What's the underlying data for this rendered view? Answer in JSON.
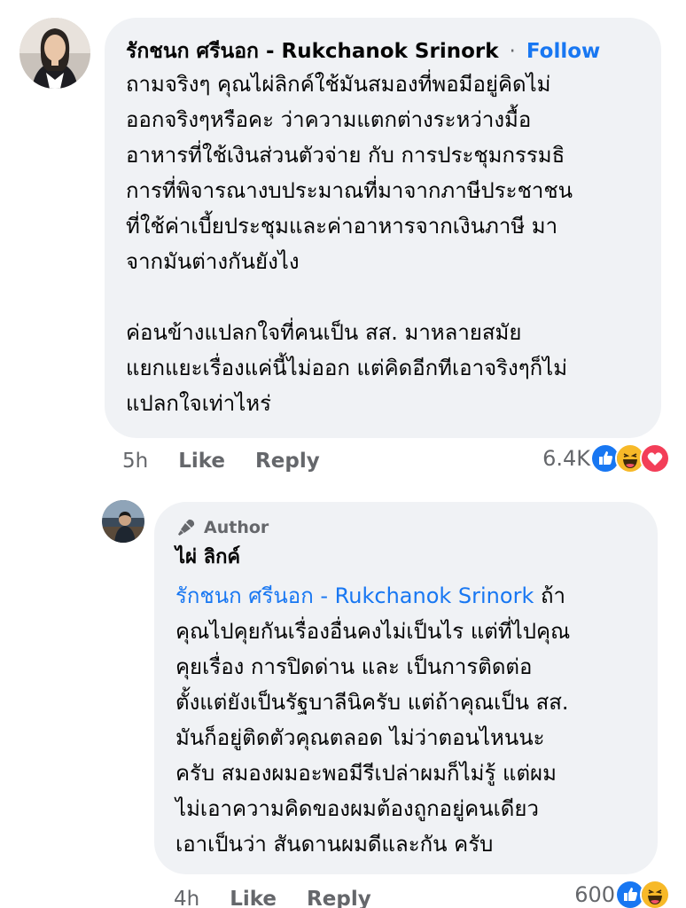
{
  "comment": {
    "author": "รักชนก ศรีนอก - Rukchanok Srinork",
    "separator": "·",
    "follow_label": "Follow",
    "lines": [
      "ถามจริงๆ คุณไผ่ลิกค์ใช้มันสมองที่พอมีอยู่คิดไม่",
      "ออกจริงๆหรือคะ ว่าความแตกต่างระหว่างมื้อ",
      "อาหารที่ใช้เงินส่วนตัวจ่าย กับ การประชุมกรรมธิ",
      "การที่พิจารณางบประมาณที่มาจากภาษีประชาชน",
      "ที่ใช้ค่าเบี้ยประชุมและค่าอาหารจากเงินภาษี มา",
      "จากมันต่างกันยังไง"
    ],
    "lines_2": [
      "ค่อนข้างแปลกใจที่คนเป็น สส. มาหลายสมัย",
      "แยกแยะเรื่องแค่นี้ไม่ออก แต่คิดอีกทีเอาจริงๆก็ไม่",
      "แปลกใจเท่าไหร่"
    ],
    "time": "5h",
    "like_label": "Like",
    "reply_label": "Reply",
    "reaction_count": "6.4K",
    "reactions": [
      "like",
      "haha",
      "love"
    ]
  },
  "reply": {
    "badge_label": "Author",
    "author": "ไผ่ ลิกค์",
    "mention": "รักชนก ศรีนอก - Rukchanok Srinork",
    "first_line_rest": " ถ้า",
    "lines": [
      "คุณไปคุยกันเรื่องอื่นคงไม่เป็นไร แต่ที่ไปคุณ",
      "คุยเรื่อง การปิดด่าน และ เป็นการติดต่อ",
      "ตั้งแต่ยังเป็นรัฐบาลีนิครับ แต่ถ้าคุณเป็น สส.",
      "มันก็อยู่ติดตัวคุณตลอด ไม่ว่าตอนไหนนะ",
      "ครับ สมองผมอะพอมีรีเปล่าผมก็ไม่รู้ แต่ผม",
      "ไม่เอาความคิดของผมต้องถูกอยู่คนเดียว",
      "เอาเป็นว่า สันดานผมดีและกัน ครับ"
    ],
    "time": "4h",
    "like_label": "Like",
    "reply_label": "Reply",
    "reaction_count": "600",
    "reactions": [
      "like",
      "haha"
    ]
  },
  "colors": {
    "bubble": "#f0f2f5",
    "link": "#1877f2",
    "meta": "#65676b",
    "like": "#1877f2",
    "haha": "#f7b928",
    "love": "#f33e58"
  }
}
